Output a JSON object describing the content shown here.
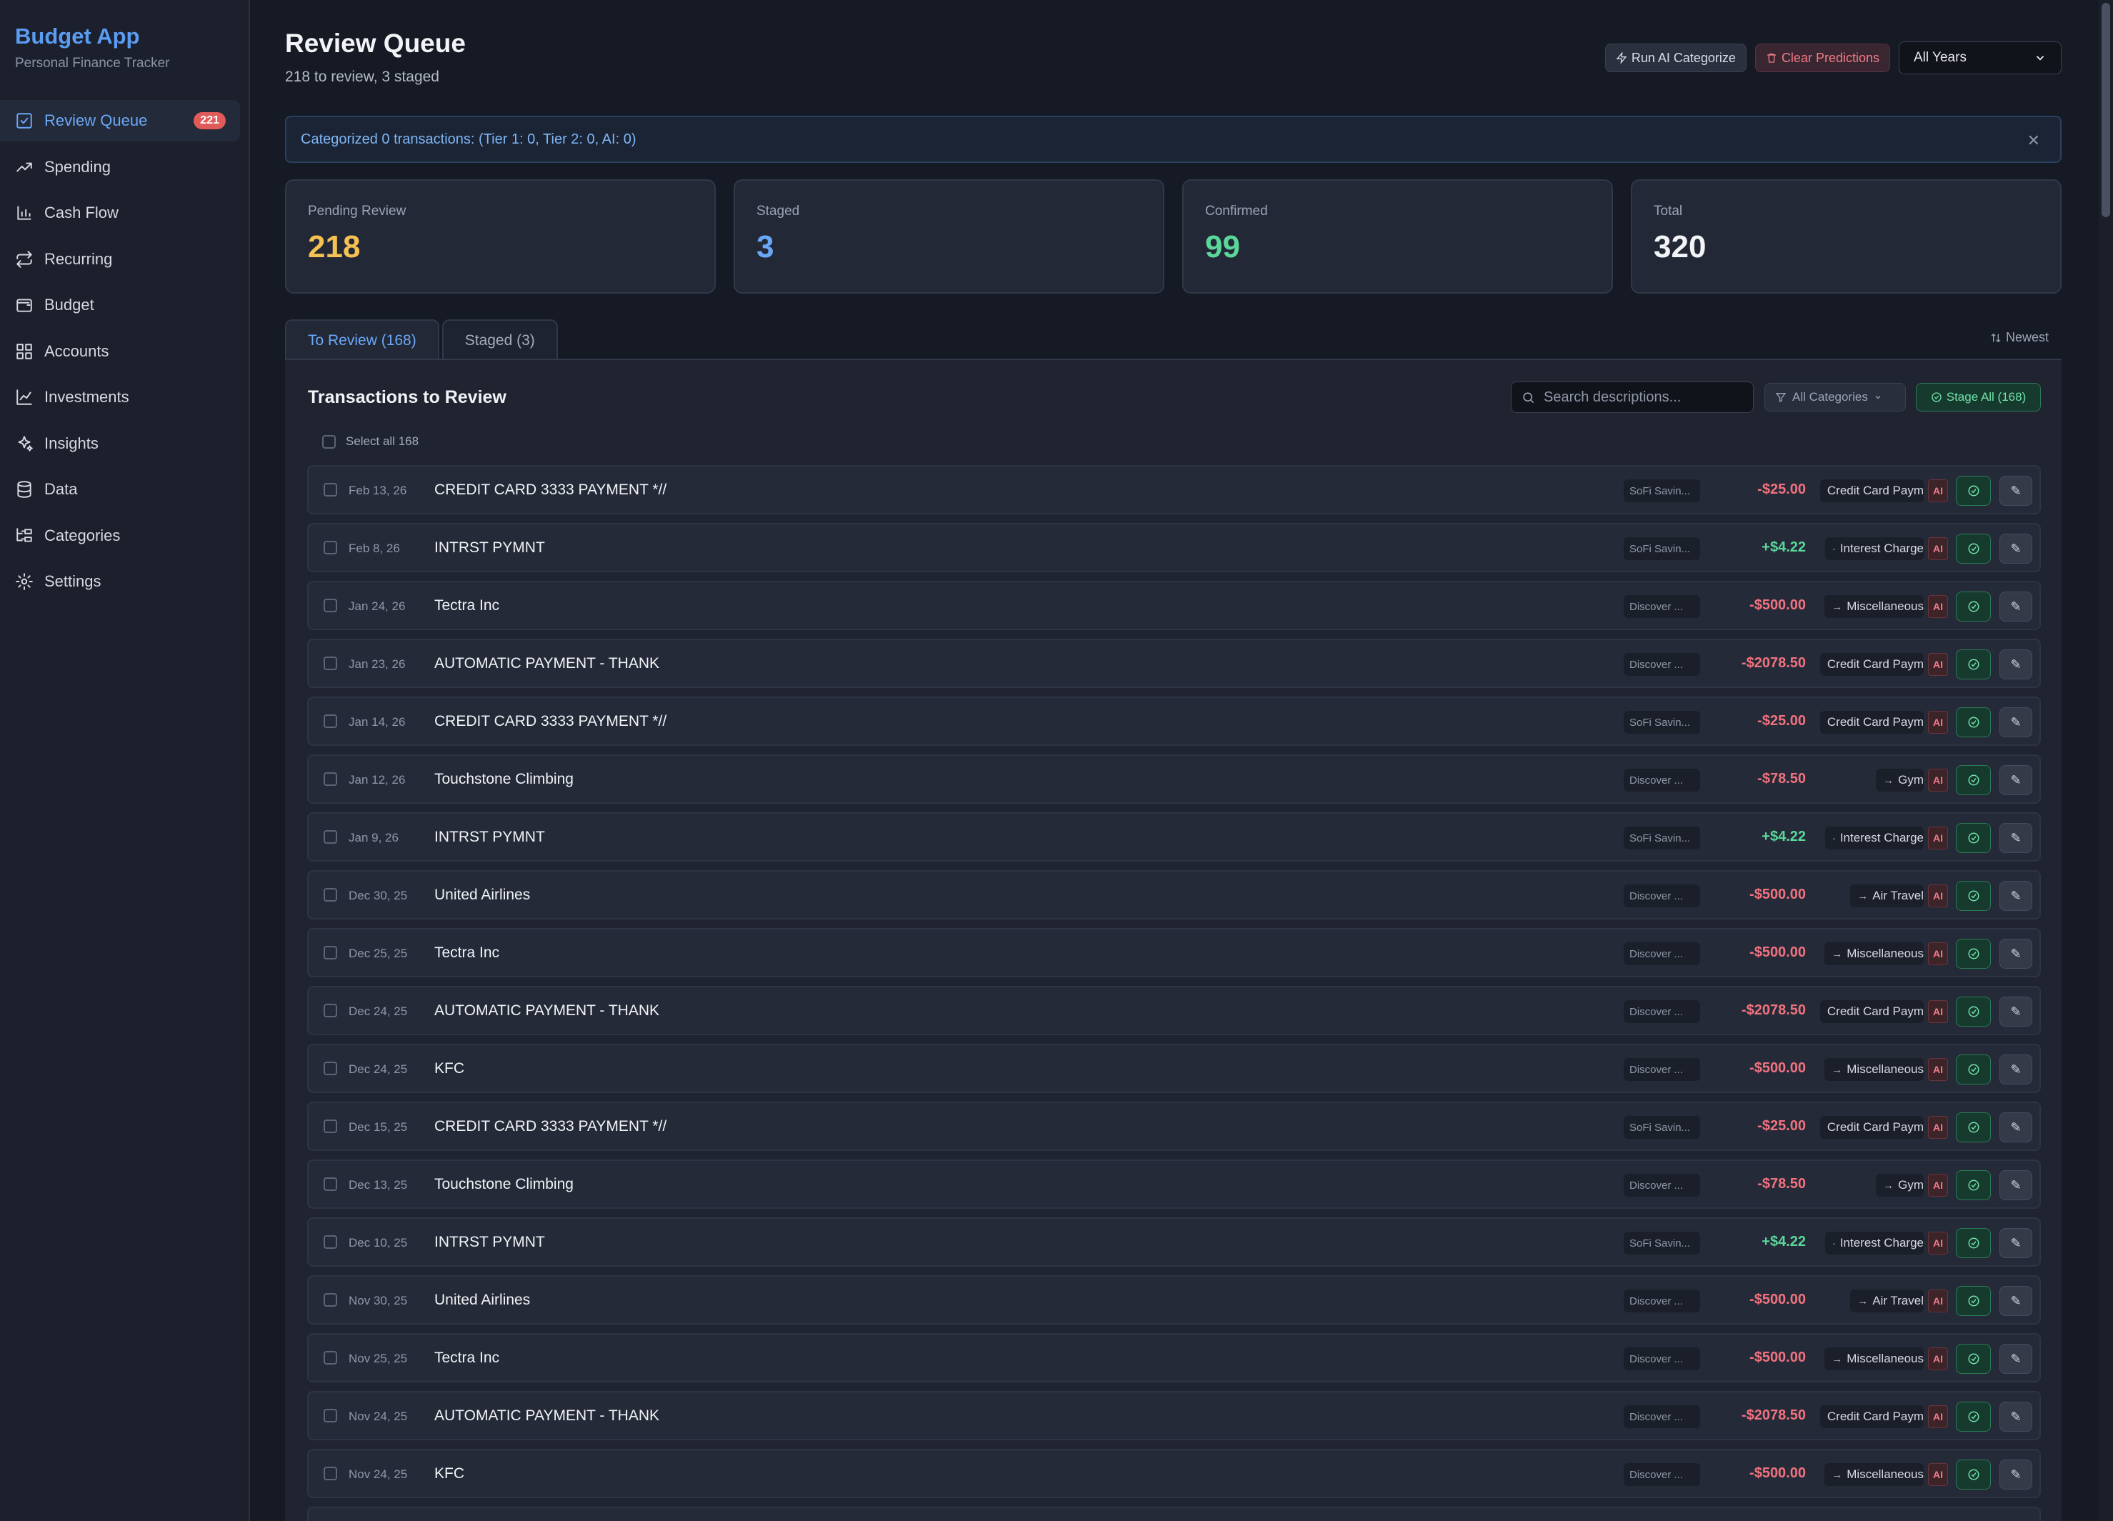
{
  "brand": {
    "title": "Budget App",
    "subtitle": "Personal Finance Tracker"
  },
  "nav": [
    {
      "label": "Review Queue",
      "icon": "check-square-icon",
      "badge": "221",
      "active": true
    },
    {
      "label": "Spending",
      "icon": "trending-up-icon"
    },
    {
      "label": "Cash Flow",
      "icon": "bar-chart-icon"
    },
    {
      "label": "Recurring",
      "icon": "repeat-icon"
    },
    {
      "label": "Budget",
      "icon": "wallet-icon"
    },
    {
      "label": "Accounts",
      "icon": "grid-icon"
    },
    {
      "label": "Investments",
      "icon": "line-chart-icon"
    },
    {
      "label": "Insights",
      "icon": "sparkles-icon"
    },
    {
      "label": "Data",
      "icon": "database-icon"
    },
    {
      "label": "Categories",
      "icon": "folder-tree-icon"
    },
    {
      "label": "Settings",
      "icon": "gear-icon"
    }
  ],
  "header": {
    "title": "Review Queue",
    "subtitle": "218 to review, 3 staged",
    "run_ai_label": "Run AI Categorize",
    "clear_label": "Clear Predictions",
    "year_select": "All Years"
  },
  "alert": {
    "text": "Categorized 0 transactions: (Tier 1: 0, Tier 2: 0, AI: 0)"
  },
  "stats": [
    {
      "label": "Pending Review",
      "value": "218",
      "color": "#f5c152"
    },
    {
      "label": "Staged",
      "value": "3",
      "color": "#6aa8f7"
    },
    {
      "label": "Confirmed",
      "value": "99",
      "color": "#5bd79a"
    },
    {
      "label": "Total",
      "value": "320",
      "color": "#f3f4f7"
    }
  ],
  "tabs": {
    "review": "To Review (168)",
    "staged": "Staged (3)",
    "sort": "Newest"
  },
  "panel": {
    "title": "Transactions to Review",
    "search_placeholder": "Search descriptions...",
    "category_filter": "All Categories",
    "stage_all": "Stage All (168)",
    "select_all": "Select all 168"
  },
  "transactions": [
    {
      "date": "Feb 13, 26",
      "desc": "CREDIT CARD 3333 PAYMENT *//",
      "account": "SoFi Savin...",
      "amount": "-$25.00",
      "sign": "neg",
      "category": "Credit Card Paym",
      "arrow": ""
    },
    {
      "date": "Feb 8, 26",
      "desc": "INTRST PYMNT",
      "account": "SoFi Savin...",
      "amount": "+$4.22",
      "sign": "pos",
      "category": "Interest Charge",
      "arrow": "·"
    },
    {
      "date": "Jan 24, 26",
      "desc": "Tectra Inc",
      "account": "Discover ...",
      "amount": "-$500.00",
      "sign": "neg",
      "category": "Miscellaneous",
      "arrow": "→"
    },
    {
      "date": "Jan 23, 26",
      "desc": "AUTOMATIC PAYMENT - THANK",
      "account": "Discover ...",
      "amount": "-$2078.50",
      "sign": "neg",
      "category": "Credit Card Paym",
      "arrow": ""
    },
    {
      "date": "Jan 14, 26",
      "desc": "CREDIT CARD 3333 PAYMENT *//",
      "account": "SoFi Savin...",
      "amount": "-$25.00",
      "sign": "neg",
      "category": "Credit Card Paym",
      "arrow": ""
    },
    {
      "date": "Jan 12, 26",
      "desc": "Touchstone Climbing",
      "account": "Discover ...",
      "amount": "-$78.50",
      "sign": "neg",
      "category": "Gym",
      "arrow": "→"
    },
    {
      "date": "Jan 9, 26",
      "desc": "INTRST PYMNT",
      "account": "SoFi Savin...",
      "amount": "+$4.22",
      "sign": "pos",
      "category": "Interest Charge",
      "arrow": "·"
    },
    {
      "date": "Dec 30, 25",
      "desc": "United Airlines",
      "account": "Discover ...",
      "amount": "-$500.00",
      "sign": "neg",
      "category": "Air Travel",
      "arrow": "→"
    },
    {
      "date": "Dec 25, 25",
      "desc": "Tectra Inc",
      "account": "Discover ...",
      "amount": "-$500.00",
      "sign": "neg",
      "category": "Miscellaneous",
      "arrow": "→"
    },
    {
      "date": "Dec 24, 25",
      "desc": "AUTOMATIC PAYMENT - THANK",
      "account": "Discover ...",
      "amount": "-$2078.50",
      "sign": "neg",
      "category": "Credit Card Paym",
      "arrow": ""
    },
    {
      "date": "Dec 24, 25",
      "desc": "KFC",
      "account": "Discover ...",
      "amount": "-$500.00",
      "sign": "neg",
      "category": "Miscellaneous",
      "arrow": "→"
    },
    {
      "date": "Dec 15, 25",
      "desc": "CREDIT CARD 3333 PAYMENT *//",
      "account": "SoFi Savin...",
      "amount": "-$25.00",
      "sign": "neg",
      "category": "Credit Card Paym",
      "arrow": ""
    },
    {
      "date": "Dec 13, 25",
      "desc": "Touchstone Climbing",
      "account": "Discover ...",
      "amount": "-$78.50",
      "sign": "neg",
      "category": "Gym",
      "arrow": "→"
    },
    {
      "date": "Dec 10, 25",
      "desc": "INTRST PYMNT",
      "account": "SoFi Savin...",
      "amount": "+$4.22",
      "sign": "pos",
      "category": "Interest Charge",
      "arrow": "·"
    },
    {
      "date": "Nov 30, 25",
      "desc": "United Airlines",
      "account": "Discover ...",
      "amount": "-$500.00",
      "sign": "neg",
      "category": "Air Travel",
      "arrow": "→"
    },
    {
      "date": "Nov 25, 25",
      "desc": "Tectra Inc",
      "account": "Discover ...",
      "amount": "-$500.00",
      "sign": "neg",
      "category": "Miscellaneous",
      "arrow": "→"
    },
    {
      "date": "Nov 24, 25",
      "desc": "AUTOMATIC PAYMENT - THANK",
      "account": "Discover ...",
      "amount": "-$2078.50",
      "sign": "neg",
      "category": "Credit Card Paym",
      "arrow": ""
    },
    {
      "date": "Nov 24, 25",
      "desc": "KFC",
      "account": "Discover ...",
      "amount": "-$500.00",
      "sign": "neg",
      "category": "Miscellaneous",
      "arrow": "→"
    },
    {
      "date": "",
      "desc": "",
      "account": "",
      "amount": "",
      "sign": "neg",
      "category": "",
      "arrow": ""
    }
  ],
  "row_labels": {
    "ai": "AI"
  }
}
